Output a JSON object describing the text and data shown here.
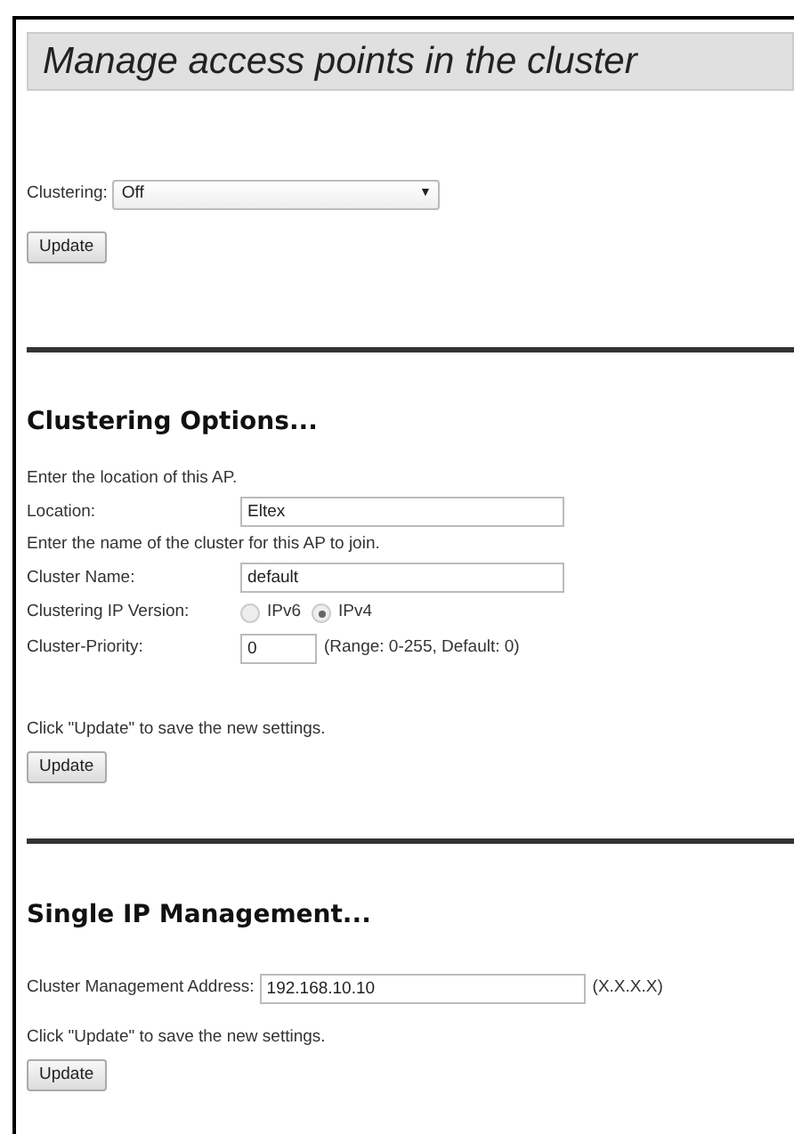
{
  "title": "Manage access points in the cluster",
  "clustering": {
    "label": "Clustering:",
    "value": "Off",
    "arrow": "▼",
    "button": "Update"
  },
  "options": {
    "heading": "Clustering Options...",
    "location_hint": "Enter the location of this AP.",
    "location_label": "Location:",
    "location_value": "Eltex",
    "name_hint": "Enter the name of the cluster for this AP to join.",
    "name_label": "Cluster Name:",
    "name_value": "default",
    "ip_label": "Clustering IP Version:",
    "ip_versions": [
      {
        "label": "IPv6",
        "selected": false
      },
      {
        "label": "IPv4",
        "selected": true
      }
    ],
    "priority_label": "Cluster-Priority:",
    "priority_value": "0",
    "priority_note": "(Range: 0-255, Default: 0)",
    "save_hint": "Click \"Update\" to save the new settings.",
    "button": "Update"
  },
  "single_ip": {
    "heading": "Single IP Management...",
    "address_label": "Cluster Management Address:",
    "address_value": "192.168.10.10",
    "address_note": "(X.X.X.X)",
    "save_hint": "Click \"Update\" to save the new settings.",
    "button": "Update"
  }
}
